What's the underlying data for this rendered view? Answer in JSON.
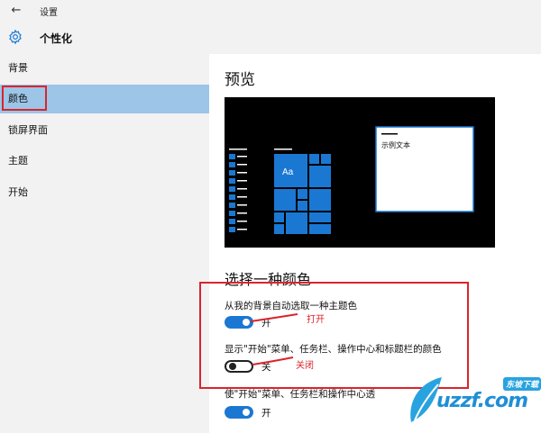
{
  "titlebar": {
    "back_icon": "back-arrow-icon",
    "app_title": "设置"
  },
  "header": {
    "icon": "gear-icon",
    "title": "个性化"
  },
  "sidebar": {
    "items": [
      {
        "label": "背景"
      },
      {
        "label": "颜色",
        "selected": true
      },
      {
        "label": "锁屏界面"
      },
      {
        "label": "主题"
      },
      {
        "label": "开始"
      }
    ]
  },
  "main": {
    "preview_title": "预览",
    "preview_sample_text": "示例文本",
    "preview_tile_label": "Aa",
    "choose_color_title": "选择一种颜色",
    "options": [
      {
        "label": "从我的背景自动选取一种主题色",
        "state": "开",
        "on": true
      },
      {
        "label": "显示\"开始\"菜单、任务栏、操作中心和标题栏的颜色",
        "state": "关",
        "on": false
      },
      {
        "label": "使\"开始\"菜单、任务栏和操作中心透",
        "state": "开",
        "on": true
      }
    ]
  },
  "annotations": {
    "open": "打开",
    "close": "关闭"
  },
  "watermark": {
    "brand": "uzzf.com",
    "tagline": "东坡下载"
  },
  "colors": {
    "accent": "#1b78d2",
    "selected_bg": "#9cc5e8",
    "annotation_red": "#d9252b",
    "chrome_bg": "#f2f2f2"
  }
}
